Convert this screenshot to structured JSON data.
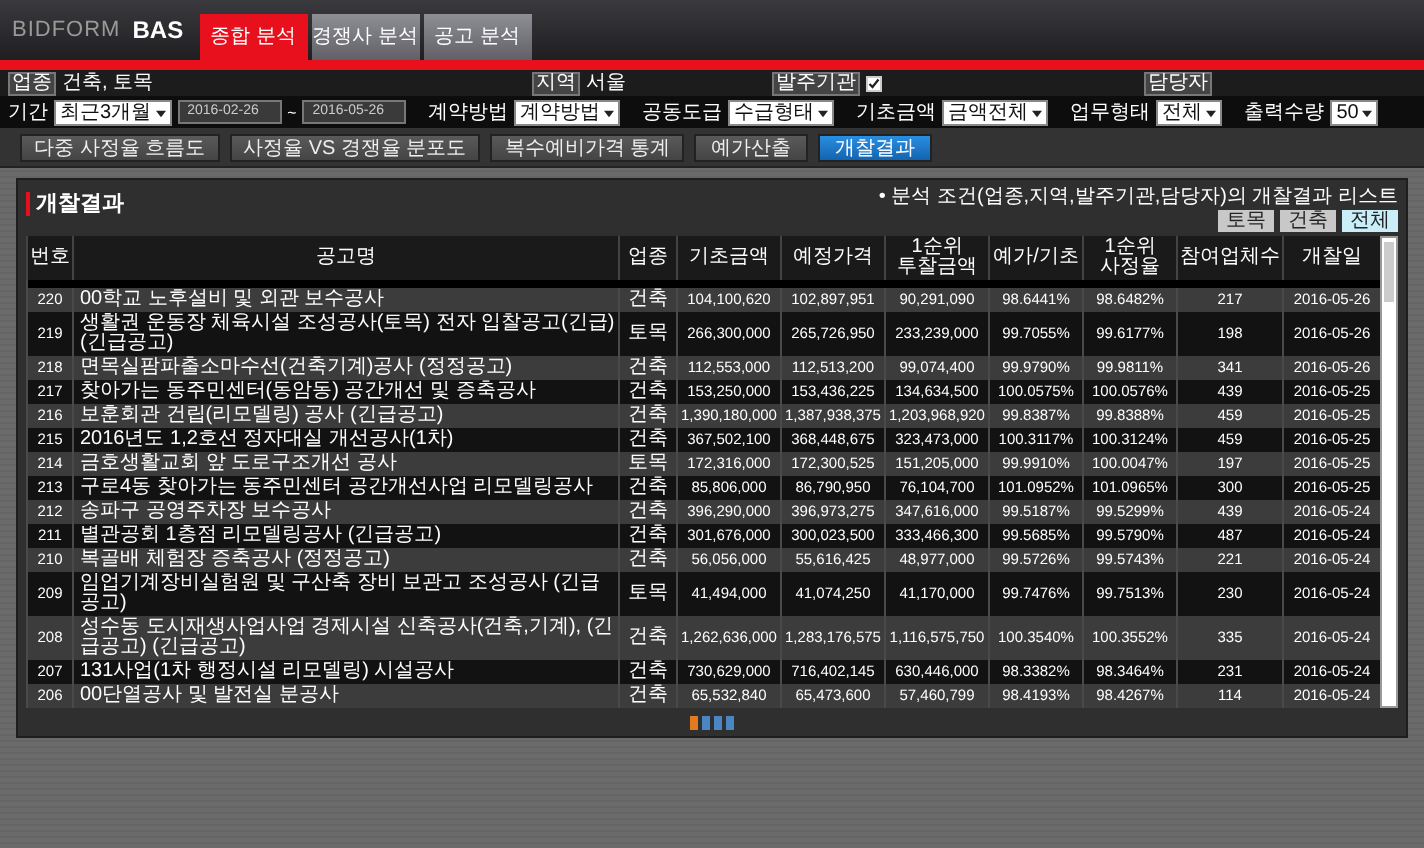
{
  "logo": {
    "brand": "BIDFORM",
    "product": "BAS"
  },
  "tabs": [
    {
      "label": "종합 분석",
      "selected": true
    },
    {
      "label": "경쟁사 분석",
      "selected": false
    },
    {
      "label": "공고 분석",
      "selected": false
    }
  ],
  "conditions": [
    {
      "label": "업종",
      "value": "건축, 토목"
    },
    {
      "label": "지역",
      "value": "서울"
    },
    {
      "label": "발주기관",
      "checked": true
    },
    {
      "label": "담당자"
    }
  ],
  "filters": {
    "period": {
      "label": "기간",
      "select": "최근3개월",
      "from": "2016-02-26",
      "sep": "~",
      "to": "2016-05-26"
    },
    "selects": [
      {
        "label": "계약방법",
        "value": "계약방법"
      },
      {
        "label": "공동도급",
        "value": "수급형태"
      },
      {
        "label": "기초금액",
        "value": "금액전체"
      },
      {
        "label": "업무형태",
        "value": "전체"
      },
      {
        "label": "출력수량",
        "value": "50"
      }
    ]
  },
  "views": [
    {
      "label": "다중 사정율 흐름도",
      "selected": false
    },
    {
      "label": "사정율 VS 경쟁율 분포도",
      "selected": false
    },
    {
      "label": "복수예비가격 통계",
      "selected": false
    },
    {
      "label": "예가산출",
      "selected": false
    },
    {
      "label": "개찰결과",
      "selected": true
    }
  ],
  "panel": {
    "title": "개찰결과",
    "note": "• 분석 조건(업종,지역,발주기관,담당자)의 개찰결과 리스트",
    "category_filters": [
      {
        "label": "토목",
        "selected": false
      },
      {
        "label": "건축",
        "selected": false
      },
      {
        "label": "전체",
        "selected": true
      }
    ]
  },
  "table": {
    "columns": [
      "번호",
      "공고명",
      "업종",
      "기초금액",
      "예정가격",
      "1순위\n투찰금액",
      "예가/기초",
      "1순위\n사정율",
      "참여업체수",
      "개찰일"
    ],
    "rows": [
      [
        "220",
        "00학교 노후설비 및 외관 보수공사",
        "건축",
        "104,100,620",
        "102,897,951",
        "90,291,090",
        "98.6441%",
        "98.6482%",
        "217",
        "2016-05-26"
      ],
      [
        "219",
        "생활권 운동장 체육시설 조성공사(토목) 전자 입찰공고(긴급)(긴급공고)",
        "토목",
        "266,300,000",
        "265,726,950",
        "233,239,000",
        "99.7055%",
        "99.6177%",
        "198",
        "2016-05-26"
      ],
      [
        "218",
        "면목실팜파출소마수선(건축기계)공사 (정정공고)",
        "건축",
        "112,553,000",
        "112,513,200",
        "99,074,400",
        "99.9790%",
        "99.9811%",
        "341",
        "2016-05-26"
      ],
      [
        "217",
        "찾아가는 동주민센터(동암동) 공간개선 및 증축공사",
        "건축",
        "153,250,000",
        "153,436,225",
        "134,634,500",
        "100.0575%",
        "100.0576%",
        "439",
        "2016-05-25"
      ],
      [
        "216",
        "보훈회관 건립(리모델링) 공사 (긴급공고)",
        "건축",
        "1,390,180,000",
        "1,387,938,375",
        "1,203,968,920",
        "99.8387%",
        "99.8388%",
        "459",
        "2016-05-25"
      ],
      [
        "215",
        "2016년도 1,2호선 정자대실 개선공사(1차)",
        "건축",
        "367,502,100",
        "368,448,675",
        "323,473,000",
        "100.3117%",
        "100.3124%",
        "459",
        "2016-05-25"
      ],
      [
        "214",
        "금호생활교회 앞 도로구조개선 공사",
        "토목",
        "172,316,000",
        "172,300,525",
        "151,205,000",
        "99.9910%",
        "100.0047%",
        "197",
        "2016-05-25"
      ],
      [
        "213",
        "구로4동 찾아가는 동주민센터 공간개선사업 리모델링공사",
        "건축",
        "85,806,000",
        "86,790,950",
        "76,104,700",
        "101.0952%",
        "101.0965%",
        "300",
        "2016-05-25"
      ],
      [
        "212",
        "송파구 공영주차장 보수공사",
        "건축",
        "396,290,000",
        "396,973,275",
        "347,616,000",
        "99.5187%",
        "99.5299%",
        "439",
        "2016-05-24"
      ],
      [
        "211",
        "별관공회 1층점 리모델링공사 (긴급공고)",
        "건축",
        "301,676,000",
        "300,023,500",
        "333,466,300",
        "99.5685%",
        "99.5790%",
        "487",
        "2016-05-24"
      ],
      [
        "210",
        "복골배 체험장 증축공사 (정정공고)",
        "건축",
        "56,056,000",
        "55,616,425",
        "48,977,000",
        "99.5726%",
        "99.5743%",
        "221",
        "2016-05-24"
      ],
      [
        "209",
        "임업기계장비실험원 및 구산축 장비 보관고 조성공사 (긴급공고)",
        "토목",
        "41,494,000",
        "41,074,250",
        "41,170,000",
        "99.7476%",
        "99.7513%",
        "230",
        "2016-05-24"
      ],
      [
        "208",
        "성수동 도시재생사업사업 경제시설 신축공사(건축,기계), (긴급공고) (긴급공고)",
        "건축",
        "1,262,636,000",
        "1,283,176,575",
        "1,116,575,750",
        "100.3540%",
        "100.3552%",
        "335",
        "2016-05-24"
      ],
      [
        "207",
        "131사업(1차 행정시설 리모델링) 시설공사",
        "건축",
        "730,629,000",
        "716,402,145",
        "630,446,000",
        "98.3382%",
        "98.3464%",
        "231",
        "2016-05-24"
      ],
      [
        "206",
        "00단열공사 및 발전실 분공사",
        "건축",
        "65,532,840",
        "65,473,600",
        "57,460,799",
        "98.4193%",
        "98.4267%",
        "114",
        "2016-05-24"
      ]
    ]
  }
}
